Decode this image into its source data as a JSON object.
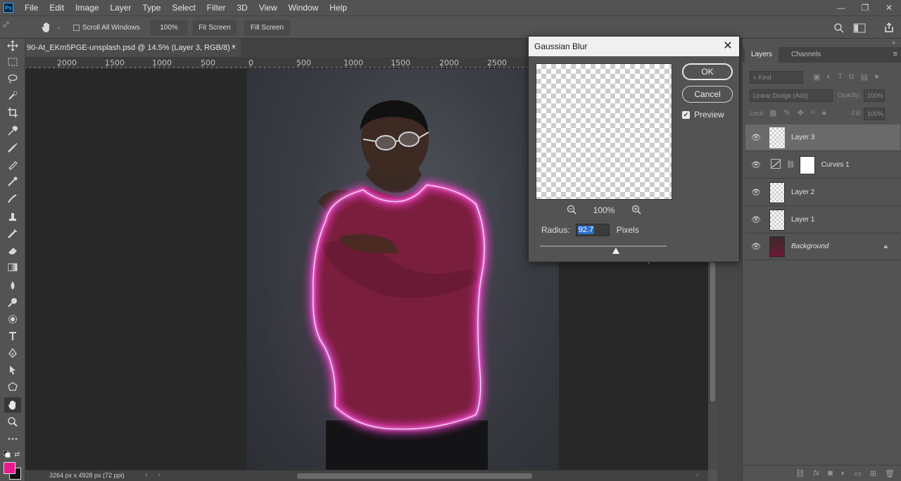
{
  "app": {
    "logo_text": "Ps"
  },
  "menu": [
    "File",
    "Edit",
    "Image",
    "Layer",
    "Type",
    "Select",
    "Filter",
    "3D",
    "View",
    "Window",
    "Help"
  ],
  "window_controls": {
    "minimize": "—",
    "restore": "❐",
    "close": "✕"
  },
  "options_bar": {
    "scroll_all_windows": "Scroll All Windows",
    "zoom_button": "100%",
    "fit_screen": "Fit Screen",
    "fill_screen": "Fill Screen"
  },
  "document": {
    "tab_title": "90-At_EKm5PGE-unsplash.psd @ 14.5% (Layer 3, RGB/8) *",
    "close_symbol": "×",
    "status": "3264 px x 4928 px (72 ppi)"
  },
  "ruler": {
    "labels": [
      "2000",
      "1500",
      "1000",
      "500",
      "0",
      "500",
      "1000",
      "1500",
      "2000",
      "2500"
    ]
  },
  "dialog": {
    "title": "Gaussian Blur",
    "close_symbol": "✕",
    "ok_label": "OK",
    "cancel_label": "Cancel",
    "preview_label": "Preview",
    "preview_checked": true,
    "preview_zoom": "100%",
    "radius_label": "Radius:",
    "radius_value": "92.7",
    "radius_unit": "Pixels",
    "slider_fraction": 0.6
  },
  "layers_panel": {
    "tabs": [
      "Layers",
      "Channels"
    ],
    "kind_filter": "Kind",
    "blend_mode": "Linear Dodge (Add)",
    "opacity_label": "Opacity:",
    "opacity_value": "100%",
    "lock_label": "Lock:",
    "fill_label": "Fill:",
    "fill_value": "100%",
    "layers": [
      {
        "name": "Layer 3",
        "selected": true
      },
      {
        "name": "Curves 1",
        "selected": false
      },
      {
        "name": "Layer 2",
        "selected": false
      },
      {
        "name": "Layer 1",
        "selected": false
      },
      {
        "name": "Background",
        "selected": false
      }
    ]
  },
  "colors": {
    "foreground": "#ea198f",
    "background": "#111111",
    "neon_glow": "#ff3dd6"
  }
}
